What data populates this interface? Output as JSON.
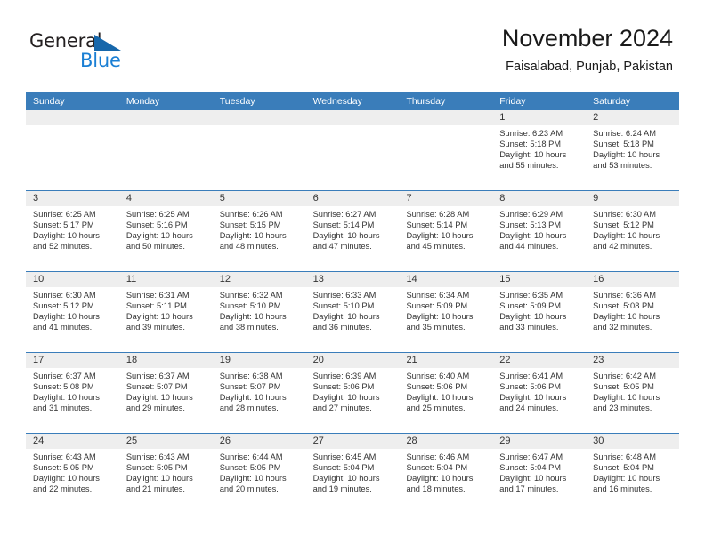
{
  "logo": {
    "word_top": "General",
    "word_bottom": "Blue",
    "triangle_color": "#1667ab",
    "blue_color": "#1a7fd4",
    "top_color": "#231f20"
  },
  "header": {
    "title": "November 2024",
    "location": "Faisalabad, Punjab, Pakistan"
  },
  "theme": {
    "header_bar": "#3a7dba",
    "daynum_strip": "#eeeeee",
    "text": "#333333"
  },
  "weekdays": [
    "Sunday",
    "Monday",
    "Tuesday",
    "Wednesday",
    "Thursday",
    "Friday",
    "Saturday"
  ],
  "weeks": [
    [
      {
        "day": "",
        "sunrise": "",
        "sunset": "",
        "daylight1": "",
        "daylight2": ""
      },
      {
        "day": "",
        "sunrise": "",
        "sunset": "",
        "daylight1": "",
        "daylight2": ""
      },
      {
        "day": "",
        "sunrise": "",
        "sunset": "",
        "daylight1": "",
        "daylight2": ""
      },
      {
        "day": "",
        "sunrise": "",
        "sunset": "",
        "daylight1": "",
        "daylight2": ""
      },
      {
        "day": "",
        "sunrise": "",
        "sunset": "",
        "daylight1": "",
        "daylight2": ""
      },
      {
        "day": "1",
        "sunrise": "Sunrise: 6:23 AM",
        "sunset": "Sunset: 5:18 PM",
        "daylight1": "Daylight: 10 hours",
        "daylight2": "and 55 minutes."
      },
      {
        "day": "2",
        "sunrise": "Sunrise: 6:24 AM",
        "sunset": "Sunset: 5:18 PM",
        "daylight1": "Daylight: 10 hours",
        "daylight2": "and 53 minutes."
      }
    ],
    [
      {
        "day": "3",
        "sunrise": "Sunrise: 6:25 AM",
        "sunset": "Sunset: 5:17 PM",
        "daylight1": "Daylight: 10 hours",
        "daylight2": "and 52 minutes."
      },
      {
        "day": "4",
        "sunrise": "Sunrise: 6:25 AM",
        "sunset": "Sunset: 5:16 PM",
        "daylight1": "Daylight: 10 hours",
        "daylight2": "and 50 minutes."
      },
      {
        "day": "5",
        "sunrise": "Sunrise: 6:26 AM",
        "sunset": "Sunset: 5:15 PM",
        "daylight1": "Daylight: 10 hours",
        "daylight2": "and 48 minutes."
      },
      {
        "day": "6",
        "sunrise": "Sunrise: 6:27 AM",
        "sunset": "Sunset: 5:14 PM",
        "daylight1": "Daylight: 10 hours",
        "daylight2": "and 47 minutes."
      },
      {
        "day": "7",
        "sunrise": "Sunrise: 6:28 AM",
        "sunset": "Sunset: 5:14 PM",
        "daylight1": "Daylight: 10 hours",
        "daylight2": "and 45 minutes."
      },
      {
        "day": "8",
        "sunrise": "Sunrise: 6:29 AM",
        "sunset": "Sunset: 5:13 PM",
        "daylight1": "Daylight: 10 hours",
        "daylight2": "and 44 minutes."
      },
      {
        "day": "9",
        "sunrise": "Sunrise: 6:30 AM",
        "sunset": "Sunset: 5:12 PM",
        "daylight1": "Daylight: 10 hours",
        "daylight2": "and 42 minutes."
      }
    ],
    [
      {
        "day": "10",
        "sunrise": "Sunrise: 6:30 AM",
        "sunset": "Sunset: 5:12 PM",
        "daylight1": "Daylight: 10 hours",
        "daylight2": "and 41 minutes."
      },
      {
        "day": "11",
        "sunrise": "Sunrise: 6:31 AM",
        "sunset": "Sunset: 5:11 PM",
        "daylight1": "Daylight: 10 hours",
        "daylight2": "and 39 minutes."
      },
      {
        "day": "12",
        "sunrise": "Sunrise: 6:32 AM",
        "sunset": "Sunset: 5:10 PM",
        "daylight1": "Daylight: 10 hours",
        "daylight2": "and 38 minutes."
      },
      {
        "day": "13",
        "sunrise": "Sunrise: 6:33 AM",
        "sunset": "Sunset: 5:10 PM",
        "daylight1": "Daylight: 10 hours",
        "daylight2": "and 36 minutes."
      },
      {
        "day": "14",
        "sunrise": "Sunrise: 6:34 AM",
        "sunset": "Sunset: 5:09 PM",
        "daylight1": "Daylight: 10 hours",
        "daylight2": "and 35 minutes."
      },
      {
        "day": "15",
        "sunrise": "Sunrise: 6:35 AM",
        "sunset": "Sunset: 5:09 PM",
        "daylight1": "Daylight: 10 hours",
        "daylight2": "and 33 minutes."
      },
      {
        "day": "16",
        "sunrise": "Sunrise: 6:36 AM",
        "sunset": "Sunset: 5:08 PM",
        "daylight1": "Daylight: 10 hours",
        "daylight2": "and 32 minutes."
      }
    ],
    [
      {
        "day": "17",
        "sunrise": "Sunrise: 6:37 AM",
        "sunset": "Sunset: 5:08 PM",
        "daylight1": "Daylight: 10 hours",
        "daylight2": "and 31 minutes."
      },
      {
        "day": "18",
        "sunrise": "Sunrise: 6:37 AM",
        "sunset": "Sunset: 5:07 PM",
        "daylight1": "Daylight: 10 hours",
        "daylight2": "and 29 minutes."
      },
      {
        "day": "19",
        "sunrise": "Sunrise: 6:38 AM",
        "sunset": "Sunset: 5:07 PM",
        "daylight1": "Daylight: 10 hours",
        "daylight2": "and 28 minutes."
      },
      {
        "day": "20",
        "sunrise": "Sunrise: 6:39 AM",
        "sunset": "Sunset: 5:06 PM",
        "daylight1": "Daylight: 10 hours",
        "daylight2": "and 27 minutes."
      },
      {
        "day": "21",
        "sunrise": "Sunrise: 6:40 AM",
        "sunset": "Sunset: 5:06 PM",
        "daylight1": "Daylight: 10 hours",
        "daylight2": "and 25 minutes."
      },
      {
        "day": "22",
        "sunrise": "Sunrise: 6:41 AM",
        "sunset": "Sunset: 5:06 PM",
        "daylight1": "Daylight: 10 hours",
        "daylight2": "and 24 minutes."
      },
      {
        "day": "23",
        "sunrise": "Sunrise: 6:42 AM",
        "sunset": "Sunset: 5:05 PM",
        "daylight1": "Daylight: 10 hours",
        "daylight2": "and 23 minutes."
      }
    ],
    [
      {
        "day": "24",
        "sunrise": "Sunrise: 6:43 AM",
        "sunset": "Sunset: 5:05 PM",
        "daylight1": "Daylight: 10 hours",
        "daylight2": "and 22 minutes."
      },
      {
        "day": "25",
        "sunrise": "Sunrise: 6:43 AM",
        "sunset": "Sunset: 5:05 PM",
        "daylight1": "Daylight: 10 hours",
        "daylight2": "and 21 minutes."
      },
      {
        "day": "26",
        "sunrise": "Sunrise: 6:44 AM",
        "sunset": "Sunset: 5:05 PM",
        "daylight1": "Daylight: 10 hours",
        "daylight2": "and 20 minutes."
      },
      {
        "day": "27",
        "sunrise": "Sunrise: 6:45 AM",
        "sunset": "Sunset: 5:04 PM",
        "daylight1": "Daylight: 10 hours",
        "daylight2": "and 19 minutes."
      },
      {
        "day": "28",
        "sunrise": "Sunrise: 6:46 AM",
        "sunset": "Sunset: 5:04 PM",
        "daylight1": "Daylight: 10 hours",
        "daylight2": "and 18 minutes."
      },
      {
        "day": "29",
        "sunrise": "Sunrise: 6:47 AM",
        "sunset": "Sunset: 5:04 PM",
        "daylight1": "Daylight: 10 hours",
        "daylight2": "and 17 minutes."
      },
      {
        "day": "30",
        "sunrise": "Sunrise: 6:48 AM",
        "sunset": "Sunset: 5:04 PM",
        "daylight1": "Daylight: 10 hours",
        "daylight2": "and 16 minutes."
      }
    ]
  ]
}
